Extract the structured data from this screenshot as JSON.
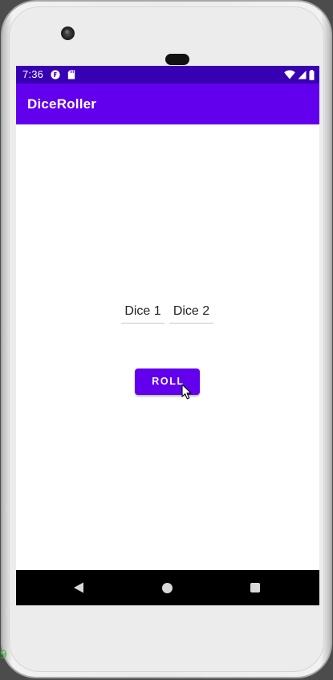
{
  "device": {
    "frame": "android-phone",
    "edge_glyph": "9"
  },
  "status_bar": {
    "time": "7:36",
    "notification_icons": [
      "app-notification-icon",
      "sd-card-icon"
    ],
    "system_icons": [
      "wifi-icon",
      "cellular-signal-icon",
      "battery-icon"
    ],
    "color": "#3700b3"
  },
  "app_bar": {
    "title": "DiceRoller",
    "color": "#6200ee"
  },
  "main": {
    "dice_1_label": "Dice 1",
    "dice_2_label": "Dice 2",
    "roll_button_label": "ROLL",
    "accent_color": "#6200ee"
  },
  "nav_bar": {
    "buttons": [
      "back-icon",
      "home-icon",
      "recents-icon"
    ]
  }
}
